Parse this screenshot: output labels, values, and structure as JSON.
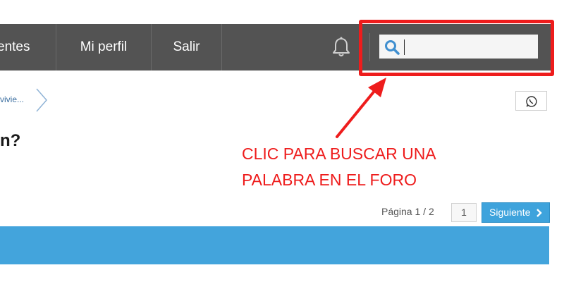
{
  "nav": {
    "items": [
      {
        "label": "entes"
      },
      {
        "label": "Mi perfil"
      },
      {
        "label": "Salir"
      }
    ]
  },
  "search": {
    "value": "",
    "placeholder": ""
  },
  "breadcrumb": {
    "text": "vivie..."
  },
  "thread": {
    "title": "n?"
  },
  "annotation": {
    "line1": "CLIC PARA BUSCAR UNA",
    "line2": "PALABRA EN EL FORO"
  },
  "pagination": {
    "page_info": "Página 1 / 2",
    "current_page": "1",
    "next_label": "Siguiente"
  },
  "colors": {
    "navbar": "#535353",
    "accent_blue": "#3ea3dc",
    "annotation_red": "#ee1c1c"
  },
  "icons": [
    "bell-icon",
    "search-icon",
    "whatsapp-icon",
    "chevron-right-icon"
  ]
}
